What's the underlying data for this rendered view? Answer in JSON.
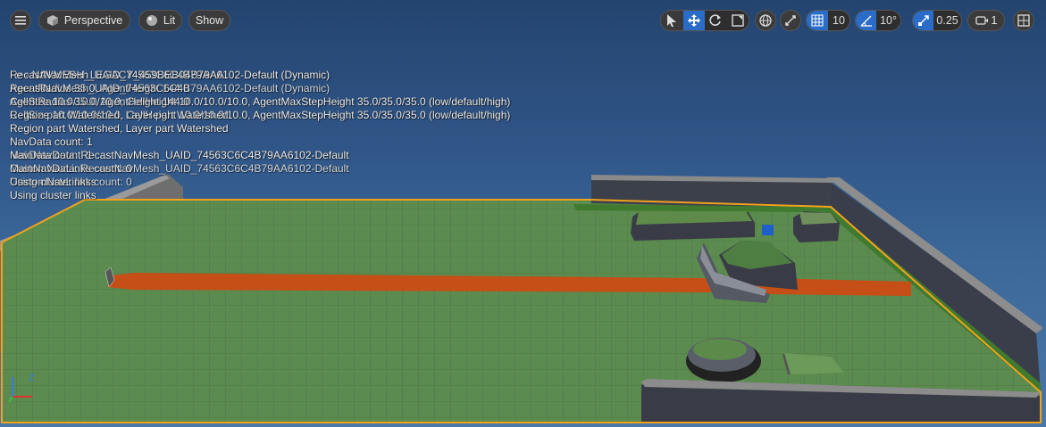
{
  "toolbar": {
    "view_mode": "Perspective",
    "lit_mode": "Lit",
    "show_label": "Show",
    "grid_snap": "10",
    "rotation_snap": "10°",
    "scale_snap": "0.25",
    "camera_speed": "1",
    "icons": {
      "menu": "hamburger-menu-icon",
      "perspective": "cube-icon",
      "lit": "sphere-icon",
      "select": "cursor-icon",
      "translate": "move-arrows-icon",
      "rotate": "rotate-icon",
      "scale": "scale-icon",
      "world": "globe-icon",
      "surface_snap": "surface-snap-icon",
      "grid": "grid-icon",
      "angle": "angle-icon",
      "scale_snap": "scale-arrow-icon",
      "camera": "camera-icon",
      "layout": "viewport-layout-icon"
    },
    "accent": "#2a6cc7"
  },
  "stats": {
    "lines": [
      [
        "RecastNavMesh_UAID_74563C6C4B79AA6102-Default (Dynamic)",
        "Fe - NAVMESH_LEGACY_459BEB04B79AA"
      ],
      [
        "AgentRadius 35.0, AgentHeight 144.0",
        "RecastNavMesh_UAID_74563C6C4B79AA6102-Default (Dynamic)"
      ],
      [
        "CellSize 10.0/10.0/10.0, CellHeight 10.0/10.0/10.0, AgentMaxStepHeight 35.0/35.0/35.0 (low/default/high)",
        "AgentRadius 35.0, AgentHeight 144.0"
      ],
      [
        "CellSize 10.0/10.0/10.0, CellHeight 10.0/10.0/10.0, AgentMaxStepHeight 35.0/35.0/35.0 (low/default/high)",
        "Region part Watershed, Layer part Watershed"
      ],
      [
        "Region part Watershed, Layer part Watershed",
        ""
      ],
      [
        "NavData count: 1",
        ""
      ],
      [
        "MainNavData: RecastNavMesh_UAID_74563C6C4B79AA6102-Default",
        "NavData count: 1"
      ],
      [
        "CustomNavLinks count: 0",
        "MainNavData: RecastNavMesh_UAID_74563C6C4B79AA6102-Default"
      ],
      [
        "Using cluster links",
        "CustomNavLinks count: 0"
      ],
      [
        "Using cluster links",
        ""
      ]
    ]
  },
  "axis": {
    "x": "#e03030",
    "y": "#3cc03c",
    "z": "#3a7ae0",
    "z_label": "Z"
  },
  "colors": {
    "ground": "#5a8a4e",
    "path": "#c45418",
    "wall": "#3a3e4a",
    "wall_top": "#8e8e8e",
    "selection": "#f0a21c"
  }
}
